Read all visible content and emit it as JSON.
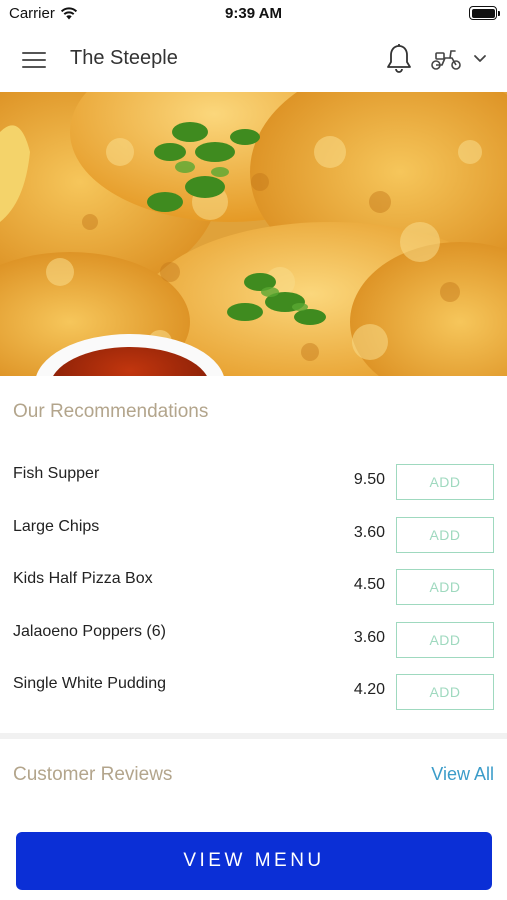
{
  "status_bar": {
    "carrier": "Carrier",
    "time": "9:39 AM"
  },
  "nav": {
    "title": "The Steeple",
    "icons": [
      "menu-icon",
      "bell-icon",
      "scooter-icon",
      "chevron-down-icon"
    ]
  },
  "hero": {
    "icon": "fried-fish-photo"
  },
  "recommendations": {
    "title": "Our Recommendations",
    "items": [
      {
        "name": "Fish Supper",
        "price": "9.50",
        "add_label": "ADD"
      },
      {
        "name": "Large Chips",
        "price": "3.60",
        "add_label": "ADD"
      },
      {
        "name": "Kids Half Pizza Box",
        "price": "4.50",
        "add_label": "ADD"
      },
      {
        "name": "Jalaoeno Poppers (6)",
        "price": "3.60",
        "add_label": "ADD"
      },
      {
        "name": "Single White Pudding",
        "price": "4.20",
        "add_label": "ADD"
      }
    ]
  },
  "reviews": {
    "title": "Customer Reviews",
    "view_all": "View All"
  },
  "cta": {
    "view_menu": "VIEW MENU"
  },
  "colors": {
    "accent_blue": "#0b2fd6",
    "add_green": "#9fd9bf",
    "section_tan": "#b3a58c",
    "link_blue": "#3b9cc9"
  }
}
